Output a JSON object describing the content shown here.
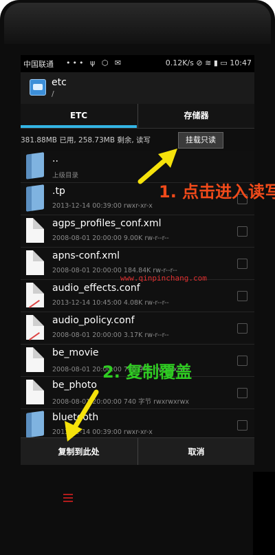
{
  "status_bar": {
    "carrier": "中国联通",
    "icons_left": "••• ψ ⬡ ✉",
    "speed": "0.12K/s",
    "time": "10:47"
  },
  "app_bar": {
    "title": "etc",
    "path": "/"
  },
  "tabs": [
    {
      "label": "ETC"
    },
    {
      "label": "存储器"
    }
  ],
  "storage_info": {
    "text": "381.88MB 已用, 258.73MB 剩余, 读写",
    "mount_button": "挂载只读"
  },
  "files": [
    {
      "name": "..",
      "meta": "上级目录",
      "type": "folder"
    },
    {
      "name": ".tp",
      "meta": "2013-12-14 00:39:00     rwxr-xr-x",
      "type": "folder"
    },
    {
      "name": "agps_profiles_conf.xml",
      "meta": "2008-08-01 20:00:00  9.00K  rw-r--r--",
      "type": "file"
    },
    {
      "name": "apns-conf.xml",
      "meta": "2008-08-01 20:00:00  184.84K  rw-r--r--",
      "type": "file"
    },
    {
      "name": "audio_effects.conf",
      "meta": "2013-12-14 10:45:00  4.08K  rw-r--r--",
      "type": "file-conf"
    },
    {
      "name": "audio_policy.conf",
      "meta": "2008-08-01 20:00:00  3.17K  rw-r--r--",
      "type": "file-conf"
    },
    {
      "name": "be_movie",
      "meta": "2008-08-01 20:00:00  740 字节  rwxrwxrwx",
      "type": "file"
    },
    {
      "name": "be_photo",
      "meta": "2008-08-01 20:00:00  740 字节  rwxrwxrwx",
      "type": "file"
    },
    {
      "name": "bluetooth",
      "meta": "2013-12-14 00:39:00     rwxr-xr-x",
      "type": "folder"
    }
  ],
  "bottom_bar": {
    "copy_here": "复制到此处",
    "cancel": "取消"
  },
  "annotations": {
    "step1": "1. 点击进入读写",
    "step2": "2. 复制覆盖",
    "watermark": "www.qinpinchang.com"
  }
}
